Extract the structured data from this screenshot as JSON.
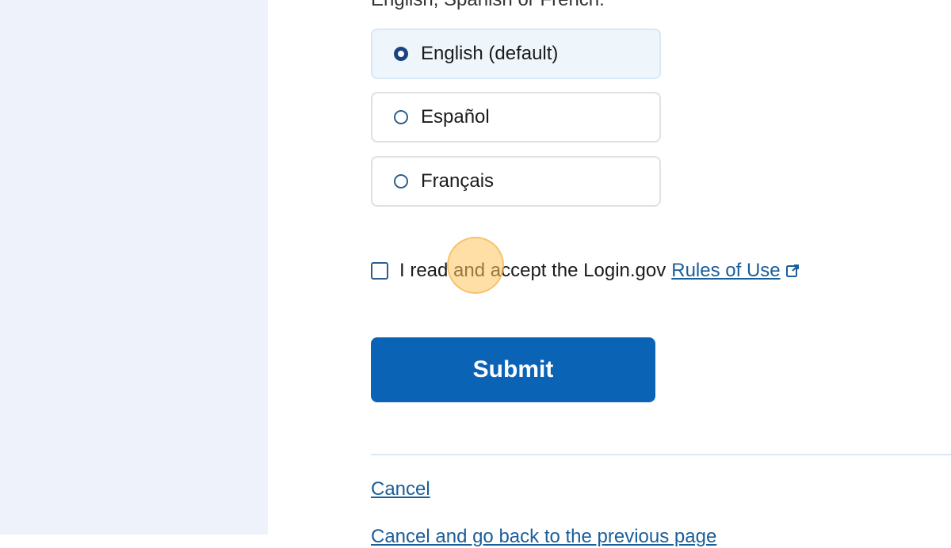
{
  "language_prompt": {
    "partial_text": "English, Spanish or French."
  },
  "language_options": [
    {
      "label": "English (default)",
      "checked": true
    },
    {
      "label": "Español",
      "checked": false
    },
    {
      "label": "Français",
      "checked": false
    }
  ],
  "terms": {
    "text": "I read and accept the Login.gov",
    "link_label": "Rules of Use",
    "checked": false
  },
  "submit": {
    "label": "Submit"
  },
  "cancel": {
    "label": "Cancel"
  },
  "footer": {
    "partial_link": "Cancel and go back to the previous page"
  },
  "colors": {
    "primary": "#0b63b6",
    "link": "#1a5e9a",
    "side_panel": "#eef3fb",
    "selected_tile": "#eff6fb",
    "click_highlight": "#ffc45c"
  }
}
